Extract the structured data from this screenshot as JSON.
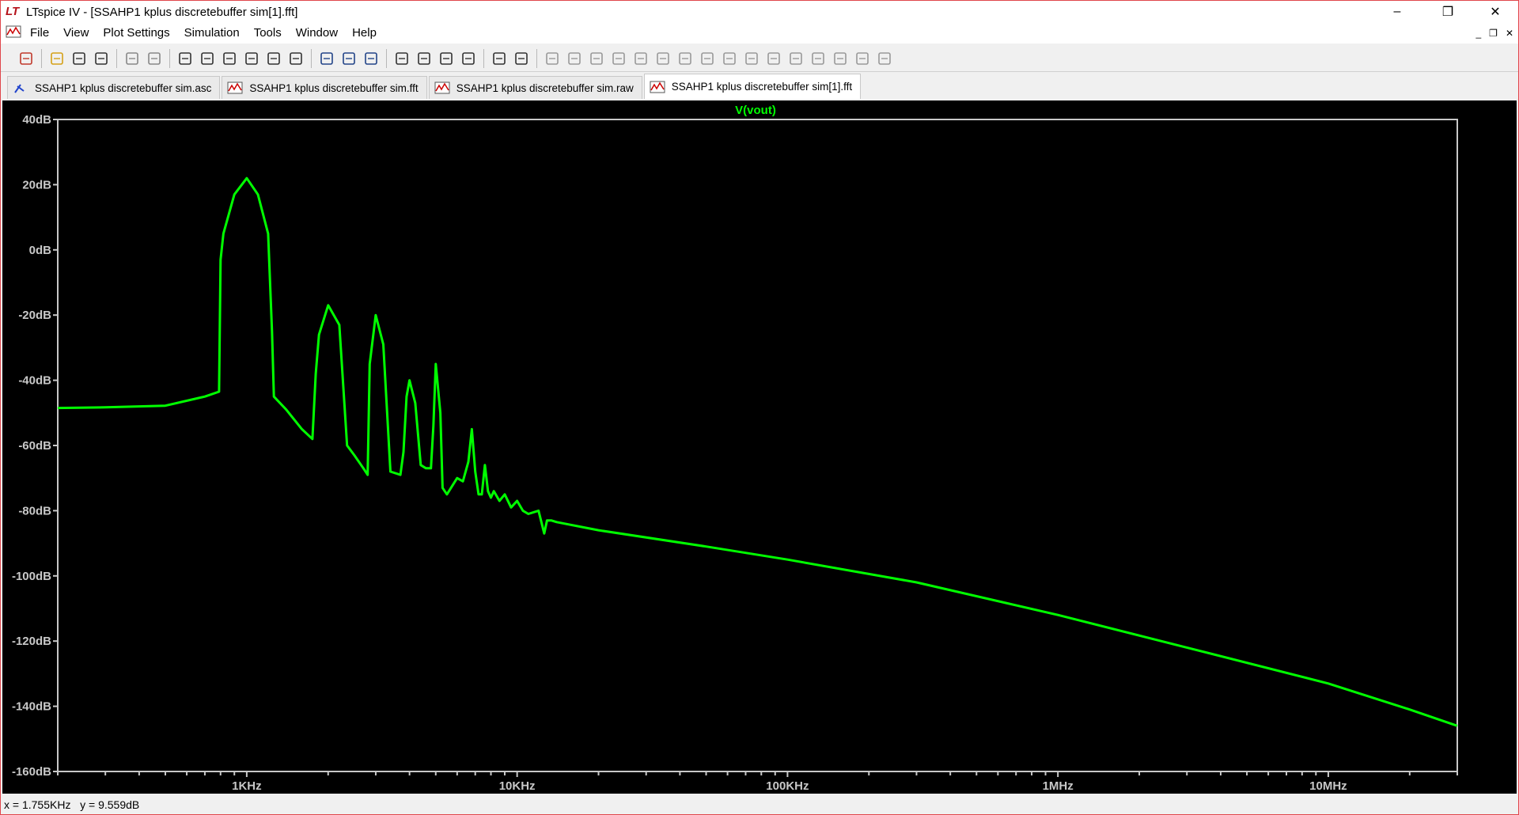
{
  "window": {
    "app_icon": "LT",
    "title": "LTspice IV - [SSAHP1 kplus discretebuffer sim[1].fft]",
    "minimize": "–",
    "maximize": "❐",
    "close": "✕"
  },
  "menu": {
    "items": [
      "File",
      "View",
      "Plot Settings",
      "Simulation",
      "Tools",
      "Window",
      "Help"
    ],
    "mdi_minimize": "_",
    "mdi_restore": "❐",
    "mdi_close": "✕"
  },
  "toolbar": {
    "buttons": [
      "new-schematic-icon",
      "open-icon",
      "save-icon",
      "control-panel-icon",
      "run-icon",
      "halt-icon",
      "zoom-in-icon",
      "zoom-area-icon",
      "zoom-out-icon",
      "zoom-fit-icon",
      "autorange-icon",
      "zoom-extent-icon",
      "tile-horizontal-icon",
      "cascade-icon",
      "tile-vertical-icon",
      "cut-icon",
      "copy-icon",
      "paste-icon",
      "find-icon",
      "print-preview-icon",
      "print-icon",
      "wire-icon",
      "ground-icon",
      "label-icon",
      "resistor-icon",
      "capacitor-icon",
      "inductor-icon",
      "diode-icon",
      "component-icon",
      "move-icon",
      "drag-icon",
      "undo-icon",
      "redo-icon",
      "rotate-icon",
      "mirror-icon",
      "text-icon",
      "spice-directive-icon"
    ]
  },
  "tabs": [
    {
      "label": "SSAHP1 kplus discretebuffer sim.asc",
      "icon": "schematic-icon",
      "active": false
    },
    {
      "label": "SSAHP1 kplus discretebuffer sim.fft",
      "icon": "waveform-icon",
      "active": false
    },
    {
      "label": "SSAHP1 kplus discretebuffer sim.raw",
      "icon": "waveform-icon",
      "active": false
    },
    {
      "label": "SSAHP1 kplus discretebuffer sim[1].fft",
      "icon": "waveform-icon",
      "active": true
    }
  ],
  "status": {
    "x_readout": "x = 1.755KHz",
    "y_readout": "y = 9.559dB"
  },
  "chart_data": {
    "type": "line",
    "title": "V(vout)",
    "xlabel": "",
    "ylabel": "",
    "xscale": "log",
    "xlim": [
      200,
      30000000
    ],
    "ylim": [
      -160,
      40
    ],
    "grid": false,
    "trace_color": "#00ff00",
    "y_ticks": [
      {
        "value": 40,
        "label": "40dB"
      },
      {
        "value": 20,
        "label": "20dB"
      },
      {
        "value": 0,
        "label": "0dB"
      },
      {
        "value": -20,
        "label": "-20dB"
      },
      {
        "value": -40,
        "label": "-40dB"
      },
      {
        "value": -60,
        "label": "-60dB"
      },
      {
        "value": -80,
        "label": "-80dB"
      },
      {
        "value": -100,
        "label": "-100dB"
      },
      {
        "value": -120,
        "label": "-120dB"
      },
      {
        "value": -140,
        "label": "-140dB"
      },
      {
        "value": -160,
        "label": "-160dB"
      }
    ],
    "x_ticks": [
      {
        "value": 1000,
        "label": "1KHz"
      },
      {
        "value": 10000,
        "label": "10KHz"
      },
      {
        "value": 100000,
        "label": "100KHz"
      },
      {
        "value": 1000000,
        "label": "1MHz"
      },
      {
        "value": 10000000,
        "label": "10MHz"
      }
    ],
    "series": [
      {
        "name": "V(vout)",
        "x": [
          200,
          300,
          500,
          700,
          790,
          800,
          820,
          900,
          1000,
          1100,
          1200,
          1240,
          1260,
          1400,
          1600,
          1750,
          1800,
          1850,
          2000,
          2200,
          2350,
          2500,
          2700,
          2800,
          2850,
          3000,
          3200,
          3400,
          3700,
          3800,
          3900,
          4000,
          4200,
          4400,
          4600,
          4800,
          4900,
          5000,
          5200,
          5300,
          5500,
          6000,
          6300,
          6600,
          6800,
          7000,
          7200,
          7400,
          7600,
          7800,
          8000,
          8200,
          8600,
          9000,
          9500,
          10000,
          10500,
          11000,
          12000,
          12600,
          12900,
          13400,
          14000,
          20000,
          50000,
          100000,
          300000,
          1000000,
          3000000,
          10000000,
          20000000,
          30000000
        ],
        "values": [
          -48.5,
          -48.3,
          -47.8,
          -45,
          -43.5,
          -3,
          5,
          17,
          22,
          17,
          5,
          -25,
          -45,
          -49,
          -55,
          -58,
          -38,
          -26,
          -17,
          -23,
          -60,
          -63,
          -67,
          -69,
          -35,
          -20,
          -29,
          -68,
          -69,
          -62,
          -45,
          -40,
          -47,
          -66,
          -67,
          -67,
          -54,
          -35,
          -50,
          -73,
          -75,
          -70,
          -71,
          -65,
          -55,
          -68,
          -75,
          -75,
          -66,
          -74,
          -76,
          -74,
          -77,
          -75,
          -79,
          -77,
          -80,
          -81,
          -80,
          -87,
          -83,
          -83,
          -83.5,
          -86,
          -91,
          -95,
          -102,
          -112,
          -122,
          -133,
          -141,
          -146
        ]
      }
    ]
  }
}
